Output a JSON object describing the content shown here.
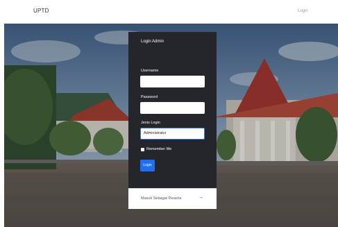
{
  "navbar": {
    "brand": "UPTD",
    "login_link": "Login"
  },
  "hero": {
    "image": "campus-building-photo"
  },
  "login_panel": {
    "title": "Login Admin",
    "username_label": "Username",
    "username_value": "",
    "password_label": "Password",
    "password_value": "",
    "jenis_login_label": "Jenis Login",
    "jenis_login_value": "Administrator",
    "remember_label": "Remember Me",
    "login_button": "Login"
  },
  "participant_link": {
    "label": "Masuk Sebagai Peserta",
    "icon": "arrow-right-icon"
  },
  "colors": {
    "panel_bg": "#24262c",
    "button_bg": "#1f6ff2",
    "active_border": "#3d7cf0"
  }
}
